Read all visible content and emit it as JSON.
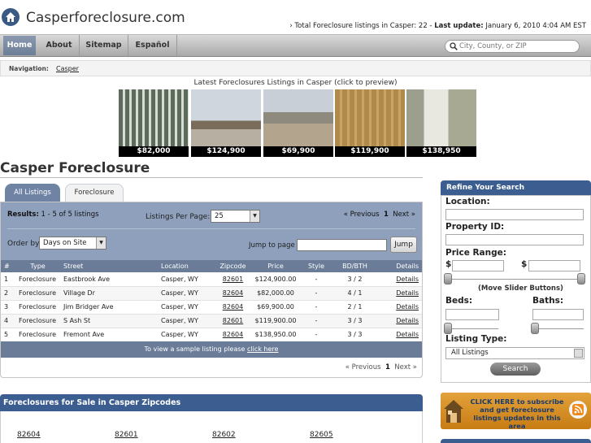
{
  "header": {
    "site_title": "Casperforeclosure.com",
    "stats_prefix": "› Total Foreclosure listings in Casper: 22 - ",
    "stats_update_label": "Last update:",
    "stats_update_value": " January 6, 2010 4:04 AM EST"
  },
  "nav": {
    "home": "Home",
    "about": "About",
    "sitemap": "Sitemap",
    "espanol": "Español",
    "search_placeholder": "City, County, or ZIP"
  },
  "breadcrumb": {
    "label": "Navigation:",
    "link": "Casper"
  },
  "latest": {
    "title": "Latest Foreclosures Listings in Casper (click to preview)",
    "items": [
      {
        "price": "$82,000"
      },
      {
        "price": "$124,900"
      },
      {
        "price": "$69,900"
      },
      {
        "price": "$119,900"
      },
      {
        "price": "$138,950"
      }
    ]
  },
  "main": {
    "title": "Casper Foreclosure",
    "tabs": [
      "All Listings",
      "Foreclosure"
    ],
    "results_label": "Results:",
    "results_value": " 1 - 5 of 5 listings",
    "per_page_label": "Listings Per Page:",
    "per_page_value": "25",
    "pager_prev": "« Previous",
    "pager_page": "1",
    "pager_next": "Next »",
    "order_by_label": "Order by",
    "order_by_value": "Days on Site",
    "jump_label": "Jump to page",
    "jump_button": "Jump",
    "columns": [
      "#",
      "Type",
      "Street",
      "Location",
      "Zipcode",
      "Price",
      "Style",
      "BD/BTH",
      "Details"
    ],
    "rows": [
      {
        "n": "1",
        "type": "Foreclosure",
        "street": "Eastbrook Ave",
        "location": "Casper, WY",
        "zip": "82601",
        "price": "$124,900.00",
        "style": "-",
        "bdbth": "3 / 2",
        "details": "Details"
      },
      {
        "n": "2",
        "type": "Foreclosure",
        "street": "Village Dr",
        "location": "Casper, WY",
        "zip": "82604",
        "price": "$82,000.00",
        "style": "-",
        "bdbth": "4 / 1",
        "details": "Details"
      },
      {
        "n": "3",
        "type": "Foreclosure",
        "street": "Jim Bridger Ave",
        "location": "Casper, WY",
        "zip": "82604",
        "price": "$69,900.00",
        "style": "-",
        "bdbth": "2 / 1",
        "details": "Details"
      },
      {
        "n": "4",
        "type": "Foreclosure",
        "street": "S Ash St",
        "location": "Casper, WY",
        "zip": "82601",
        "price": "$119,900.00",
        "style": "-",
        "bdbth": "3 / 3",
        "details": "Details"
      },
      {
        "n": "5",
        "type": "Foreclosure",
        "street": "Fremont Ave",
        "location": "Casper, WY",
        "zip": "82604",
        "price": "$138,950.00",
        "style": "-",
        "bdbth": "3 / 3",
        "details": "Details"
      }
    ],
    "sample_text": "To view a sample listing please ",
    "sample_link": "click here"
  },
  "zipcodes": {
    "title": "Foreclosures for Sale in Casper Zipcodes",
    "items": [
      "82604",
      "82601",
      "82602",
      "82605"
    ]
  },
  "refine": {
    "title": "Refine Your Search",
    "location_label": "Location:",
    "property_id_label": "Property ID:",
    "price_range_label": "Price Range:",
    "currency": "$",
    "slider_note": "(Move Slider Buttons)",
    "beds_label": "Beds:",
    "baths_label": "Baths:",
    "listing_type_label": "Listing Type:",
    "listing_type_value": "All Listings",
    "search_button": "Search"
  },
  "subscribe": {
    "text": "CLICK HERE to subscribe and get foreclosure listings updates in this area"
  },
  "colors": {
    "nav_blue": "#3b5d90",
    "table_header": "#6a7c98",
    "controls_bg": "#8ea0bc",
    "subscribe_orange": "#d88e24"
  }
}
